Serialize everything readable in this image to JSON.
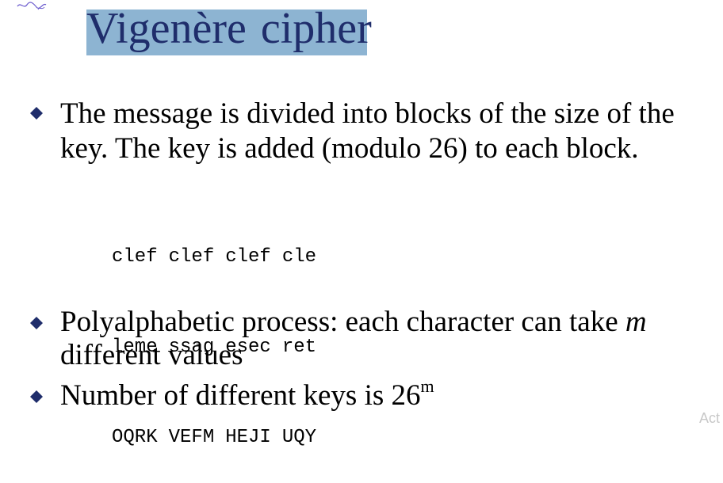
{
  "slide": {
    "title_words": [
      "Vigenère",
      "cipher"
    ],
    "bullets": [
      {
        "lines": [
          "The message is divided into blocks of the size of the",
          "key. The key is added (modulo 26) to each block."
        ]
      },
      {
        "line1_prefix": "Polyalphabetic process: each character can take ",
        "line1_italic": "m",
        "line2": "different values"
      },
      {
        "text": "Number of different keys is 26",
        "superscript": "m"
      }
    ],
    "code_rows": [
      [
        "clef",
        "clef",
        "clef",
        "cle"
      ],
      [
        "leme",
        "ssag",
        "esec",
        "ret"
      ],
      [
        "OQRK",
        "VEFM",
        "HEJI",
        "UQY"
      ]
    ],
    "watermark": "Act"
  },
  "colors": {
    "title_text": "#1f2d6b",
    "title_highlight": "#8db4d2",
    "bullet": "#1f2d6b",
    "scribble": "#6a5acd"
  },
  "icons": {
    "bullet": "diamond-bullet-icon",
    "scribble": "pen-scribble-icon"
  }
}
